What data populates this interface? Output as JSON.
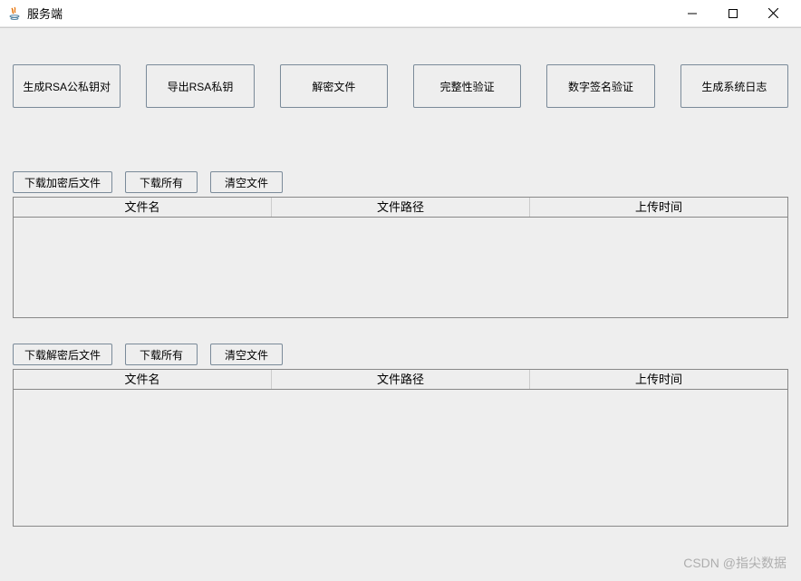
{
  "window": {
    "title": "服务端"
  },
  "toolbar": {
    "generate_rsa_keypair": "生成RSA公私钥对",
    "export_rsa_private": "导出RSA私钥",
    "decrypt_file": "解密文件",
    "integrity_check": "完整性验证",
    "digital_signature_verify": "数字签名验证",
    "generate_system_log": "生成系统日志"
  },
  "section_encrypted": {
    "download_encrypted": "下载加密后文件",
    "download_all": "下载所有",
    "clear_files": "清空文件",
    "columns": {
      "filename": "文件名",
      "filepath": "文件路径",
      "upload_time": "上传时间"
    },
    "rows": []
  },
  "section_decrypted": {
    "download_decrypted": "下载解密后文件",
    "download_all": "下载所有",
    "clear_files": "清空文件",
    "columns": {
      "filename": "文件名",
      "filepath": "文件路径",
      "upload_time": "上传时间"
    },
    "rows": []
  },
  "watermark": "CSDN @指尖数据"
}
